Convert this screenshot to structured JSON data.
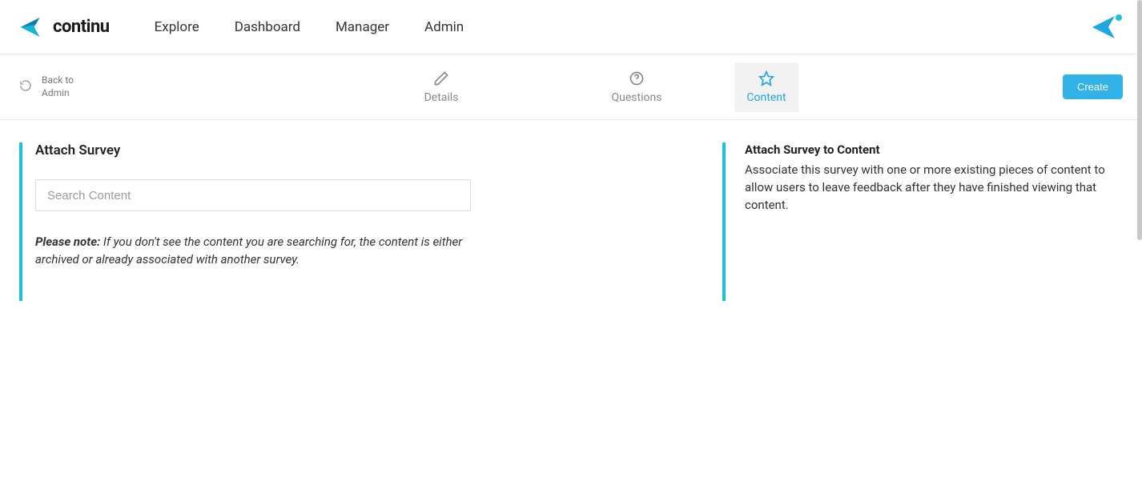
{
  "brand": {
    "name": "continu"
  },
  "nav": {
    "items": [
      {
        "label": "Explore"
      },
      {
        "label": "Dashboard"
      },
      {
        "label": "Manager"
      },
      {
        "label": "Admin"
      }
    ]
  },
  "toolbar": {
    "back_line1": "Back to",
    "back_line2": "Admin",
    "create_label": "Create",
    "tabs": [
      {
        "label": "Details"
      },
      {
        "label": "Questions"
      },
      {
        "label": "Content"
      }
    ]
  },
  "panel": {
    "title": "Attach Survey",
    "search_placeholder": "Search Content",
    "note_prefix": "Please note:",
    "note_body": "If you don't see the content you are searching for, the content is either archived or already associated with another survey."
  },
  "help": {
    "title": "Attach Survey to Content",
    "body": "Associate this survey with one or more existing pieces of content to allow users to leave feedback after they have finished viewing that content."
  },
  "colors": {
    "accent": "#1ec1dc",
    "link_active": "#1ea7e0",
    "button": "#31b2e8"
  }
}
